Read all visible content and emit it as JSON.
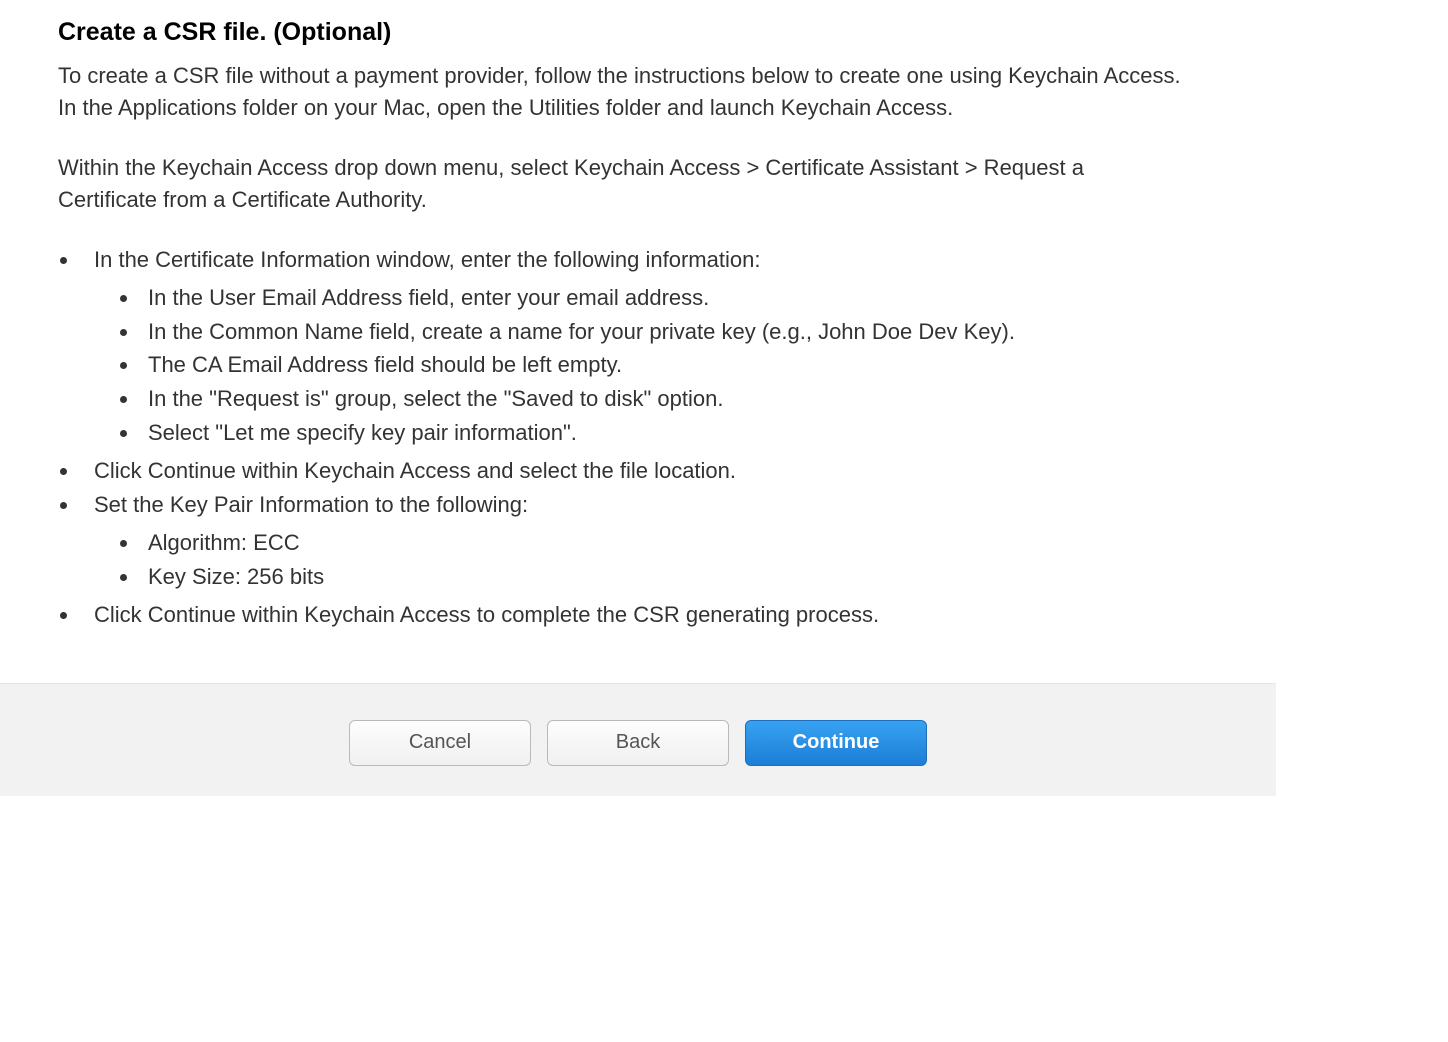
{
  "heading": "Create a CSR file. (Optional)",
  "para1": "To create a CSR file without a payment provider, follow the instructions below to create one using Keychain Access. In the Applications folder on your Mac, open the Utilities folder and launch Keychain Access.",
  "para2": "Within the Keychain Access drop down menu, select Keychain Access > Certificate Assistant > Request a Certificate from a Certificate Authority.",
  "list": {
    "item1": "In the Certificate Information window, enter the following information:",
    "item1_sub": {
      "a": "In the User Email Address field, enter your email address.",
      "b": "In the Common Name field, create a name for your private key (e.g., John Doe Dev Key).",
      "c": "The CA Email Address field should be left empty.",
      "d": "In the \"Request is\" group, select the \"Saved to disk\" option.",
      "e": "Select \"Let me specify key pair information\"."
    },
    "item2": "Click Continue within Keychain Access and select the file location.",
    "item3": "Set the Key Pair Information to the following:",
    "item3_sub": {
      "a": "Algorithm: ECC",
      "b": "Key Size: 256 bits"
    },
    "item4": "Click Continue within Keychain Access to complete the CSR generating process."
  },
  "buttons": {
    "cancel": "Cancel",
    "back": "Back",
    "continue": "Continue"
  }
}
